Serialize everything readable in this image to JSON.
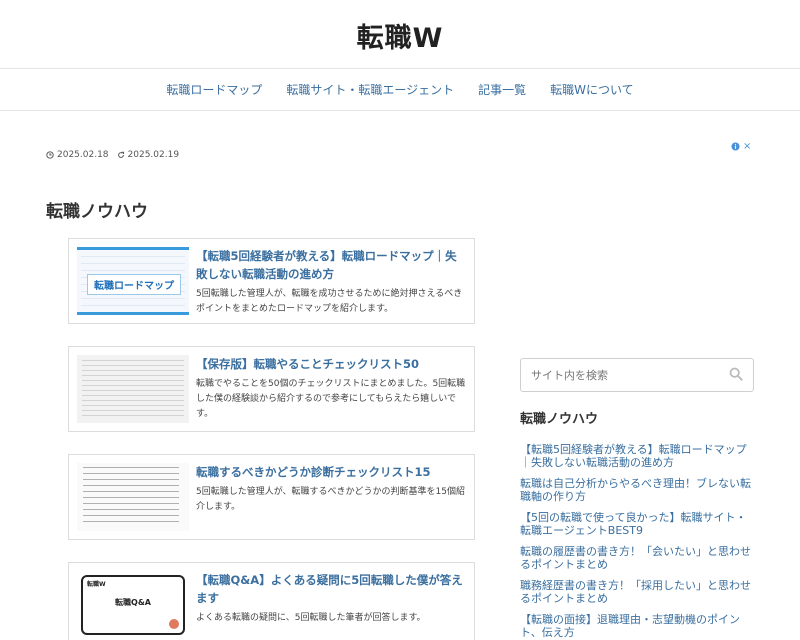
{
  "site": {
    "title": "転職W"
  },
  "nav": {
    "items": [
      {
        "label": "転職ロードマップ"
      },
      {
        "label": "転職サイト・転職エージェント"
      },
      {
        "label": "記事一覧"
      },
      {
        "label": "転職Wについて"
      }
    ]
  },
  "page": {
    "published": "2025.02.18",
    "updated": "2025.02.19",
    "heading": "転職ノウハウ"
  },
  "ad": {
    "close_label": "×"
  },
  "cards": [
    {
      "title": "【転職5回経験者が教える】転職ロードマップ｜失敗しない転職活動の進め方",
      "desc": "5回転職した管理人が、転職を成功させるために絶対押さえるべきポイントをまとめたロードマップを紹介します。",
      "thumb_label": "転職ロードマップ"
    },
    {
      "title": "【保存版】転職やることチェックリスト50",
      "desc": "転職でやることを50個のチェックリストにまとめました。5回転職した僕の経験談から紹介するので参考にしてもらえたら嬉しいです。"
    },
    {
      "title": "転職するべきかどうか診断チェックリスト15",
      "desc": "5回転職した管理人が、転職するべきかどうかの判断基準を15個紹介します。"
    },
    {
      "title": "【転職Q&A】よくある疑問に5回転職した僕が答えます",
      "desc": "よくある転職の疑問に、5回転職した筆者が回答します。",
      "thumb_brand": "転職W",
      "thumb_label": "転職Q&A"
    }
  ],
  "sidebar": {
    "search_placeholder": "サイト内を検索",
    "heading": "転職ノウハウ",
    "links": [
      "【転職5回経験者が教える】転職ロードマップ｜失敗しない転職活動の進め方",
      "転職は自己分析からやるべき理由！ブレない転職軸の作り方",
      "【5回の転職で使って良かった】転職サイト・転職エージェントBEST9",
      "転職の履歴書の書き方！「会いたい」と思わせるポイントまとめ",
      "職務経歴書の書き方！「採用したい」と思わせるポイントまとめ",
      "【転職の面接】退職理由・志望動機のポイント、伝え方"
    ]
  },
  "colors": {
    "link": "#3a6f9f",
    "accent": "#3a9bdc"
  },
  "icons": {
    "published": "clock-icon",
    "updated": "refresh-icon",
    "search": "search-icon",
    "ad": "info-icon"
  }
}
